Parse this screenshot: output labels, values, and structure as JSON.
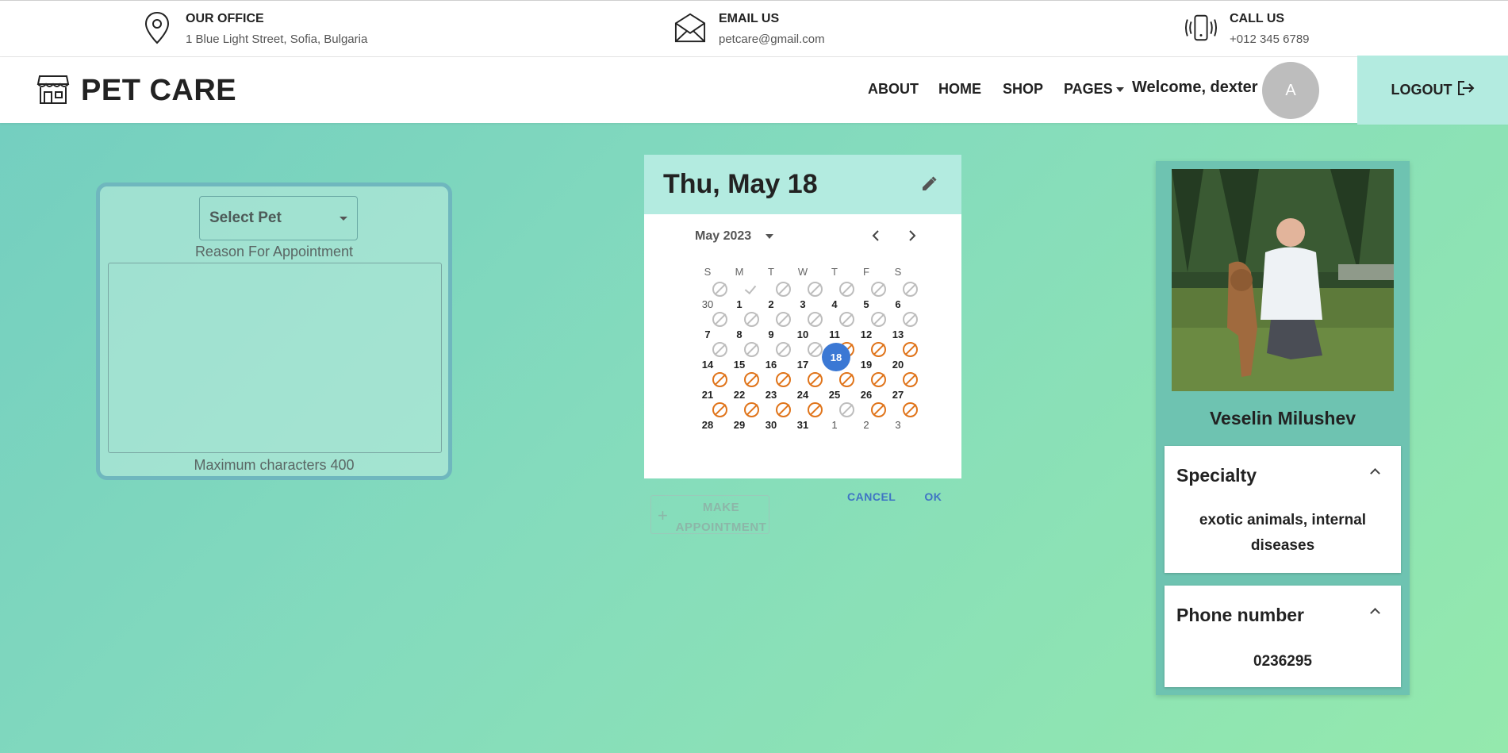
{
  "info": {
    "office": {
      "title": "OUR OFFICE",
      "value": "1 Blue Light Street, Sofia, Bulgaria",
      "icon": "location-pin-icon"
    },
    "email": {
      "title": "EMAIL US",
      "value": "petcare@gmail.com",
      "icon": "envelope-icon"
    },
    "call": {
      "title": "CALL US",
      "value": "+012 345 6789",
      "icon": "phone-icon"
    }
  },
  "nav": {
    "brand": "PET CARE",
    "items": [
      "ABOUT",
      "HOME",
      "SHOP",
      "PAGES"
    ],
    "welcome": "Welcome, dexter",
    "avatar_letter": "A",
    "logout": "LOGOUT"
  },
  "form": {
    "select_pet": "Select Pet",
    "reason_label": "Reason For Appointment",
    "reason_value": "",
    "max_chars": "Maximum characters 400"
  },
  "calendar": {
    "selected_label": "Thu, May 18",
    "month_label": "May 2023",
    "weekdays": [
      "S",
      "M",
      "T",
      "W",
      "T",
      "F",
      "S"
    ],
    "weeks": [
      [
        {
          "d": "30",
          "m": "grey",
          "o": true
        },
        {
          "d": "1",
          "m": "check"
        },
        {
          "d": "2",
          "m": "grey"
        },
        {
          "d": "3",
          "m": "grey"
        },
        {
          "d": "4",
          "m": "grey"
        },
        {
          "d": "5",
          "m": "grey"
        },
        {
          "d": "6",
          "m": "grey"
        }
      ],
      [
        {
          "d": "7",
          "m": "grey"
        },
        {
          "d": "8",
          "m": "grey"
        },
        {
          "d": "9",
          "m": "grey"
        },
        {
          "d": "10",
          "m": "grey"
        },
        {
          "d": "11",
          "m": "grey"
        },
        {
          "d": "12",
          "m": "grey"
        },
        {
          "d": "13",
          "m": "grey"
        }
      ],
      [
        {
          "d": "14",
          "m": "grey"
        },
        {
          "d": "15",
          "m": "grey"
        },
        {
          "d": "16",
          "m": "grey"
        },
        {
          "d": "17",
          "m": "grey"
        },
        {
          "d": "18",
          "m": "orange",
          "sel": true
        },
        {
          "d": "19",
          "m": "orange"
        },
        {
          "d": "20",
          "m": "orange"
        }
      ],
      [
        {
          "d": "21",
          "m": "orange"
        },
        {
          "d": "22",
          "m": "orange"
        },
        {
          "d": "23",
          "m": "orange"
        },
        {
          "d": "24",
          "m": "orange"
        },
        {
          "d": "25",
          "m": "orange"
        },
        {
          "d": "26",
          "m": "orange"
        },
        {
          "d": "27",
          "m": "orange"
        }
      ],
      [
        {
          "d": "28",
          "m": "orange"
        },
        {
          "d": "29",
          "m": "orange"
        },
        {
          "d": "30",
          "m": "orange"
        },
        {
          "d": "31",
          "m": "orange"
        },
        {
          "d": "1",
          "m": "grey",
          "o": true
        },
        {
          "d": "2",
          "m": "orange",
          "o": true
        },
        {
          "d": "3",
          "m": "orange",
          "o": true
        }
      ]
    ],
    "cancel": "CANCEL",
    "ok": "OK",
    "make_appointment": "MAKE APPOINTMENT"
  },
  "doctor": {
    "name": "Veselin Milushev",
    "specialty_title": "Specialty",
    "specialty_value": "exotic animals, internal diseases",
    "phone_title": "Phone number",
    "phone_value": "0236295"
  },
  "colors": {
    "accent": "#b3ebe0",
    "selected_day": "#3b78d4",
    "unavailable": "#e0741a",
    "action_blue": "#3f74c4"
  }
}
